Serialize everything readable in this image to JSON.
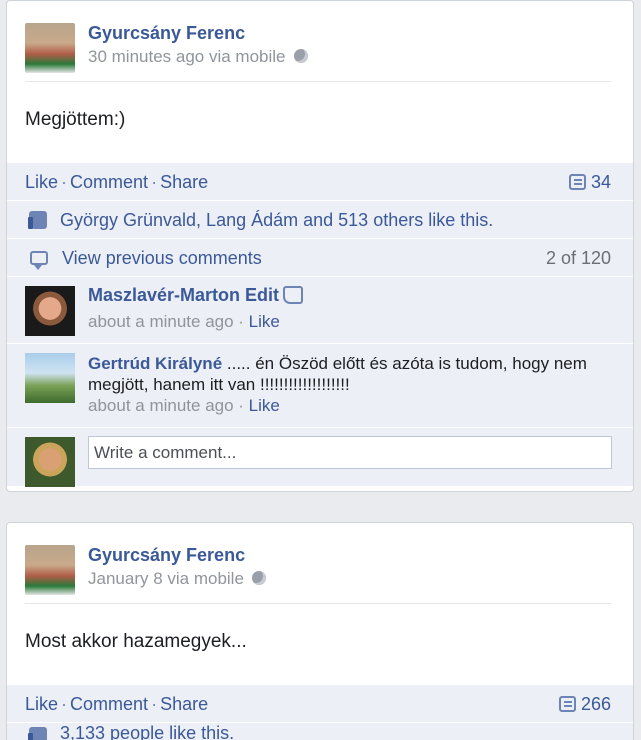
{
  "posts": [
    {
      "author": "Gyurcsány Ferenc",
      "meta": "30 minutes ago via mobile",
      "text": "Megjöttem:)",
      "actions": {
        "like": "Like",
        "comment": "Comment",
        "share": "Share",
        "sep": "·"
      },
      "comment_count": "34",
      "likes_text": "György Grünvald, Lang Ádám and 513 others like this.",
      "view_previous": "View previous comments",
      "pager": "2 of 120",
      "comments": [
        {
          "name": "Maszlavér-Marton Edit",
          "text": "",
          "time": "about a minute ago",
          "like": "Like"
        },
        {
          "name": "Gertrúd Királyné",
          "text": "..... én Öszöd előtt és azóta is tudom, hogy nem megjött, hanem itt van !!!!!!!!!!!!!!!!!!!",
          "time": "about a minute ago",
          "like": "Like"
        }
      ],
      "write_placeholder": "Write a comment..."
    },
    {
      "author": "Gyurcsány Ferenc",
      "meta": "January 8 via mobile",
      "text": "Most akkor hazamegyek...",
      "actions": {
        "like": "Like",
        "comment": "Comment",
        "share": "Share",
        "sep": "·"
      },
      "comment_count": "266",
      "likes_text": "3,133 people like this."
    }
  ],
  "colors": {
    "link": "#3b5998",
    "meta": "#90949c",
    "bar": "#eceff5"
  }
}
